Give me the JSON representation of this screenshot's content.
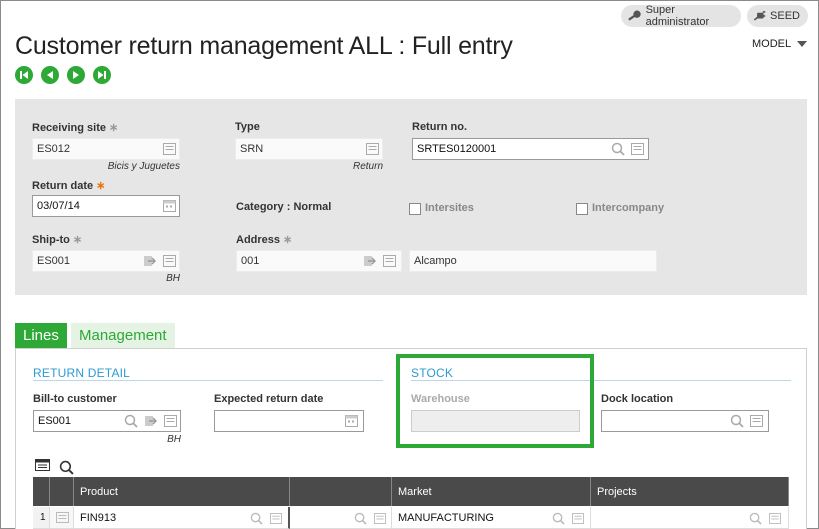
{
  "user": {
    "role": "Super administrator",
    "folder": "SEED"
  },
  "page": {
    "title": "Customer return management ALL : Full entry",
    "model_label": "MODEL"
  },
  "header": {
    "receiving_site": {
      "label": "Receiving site",
      "value": "ES012",
      "desc": "Bicis y Juguetes"
    },
    "type": {
      "label": "Type",
      "value": "SRN",
      "desc": "Return"
    },
    "return_no": {
      "label": "Return no.",
      "value": "SRTES0120001"
    },
    "return_date": {
      "label": "Return date",
      "value": "03/07/14"
    },
    "category": {
      "text": "Category : Normal"
    },
    "intersites": {
      "label": "Intersites"
    },
    "intercompany": {
      "label": "Intercompany"
    },
    "ship_to": {
      "label": "Ship-to",
      "value": "ES001",
      "desc": "BH"
    },
    "address": {
      "label": "Address",
      "value": "001",
      "name": "Alcampo"
    }
  },
  "tabs": [
    {
      "label": "Lines"
    },
    {
      "label": "Management"
    }
  ],
  "return_detail": {
    "title": "RETURN DETAIL",
    "bill_to": {
      "label": "Bill-to customer",
      "value": "ES001",
      "desc": "BH"
    },
    "expected_date": {
      "label": "Expected return date",
      "value": ""
    }
  },
  "stock": {
    "title": "STOCK",
    "warehouse": {
      "label": "Warehouse",
      "value": ""
    },
    "dock": {
      "label": "Dock location",
      "value": ""
    }
  },
  "grid": {
    "columns": [
      "Product",
      "Market",
      "Projects"
    ],
    "rows": [
      {
        "num": "1",
        "product": "FIN913",
        "market": "MANUFACTURING",
        "projects": ""
      }
    ]
  },
  "colors": {
    "accent_green": "#2ea836",
    "section_blue": "#2b9bd3",
    "required_orange": "#e8720c"
  }
}
